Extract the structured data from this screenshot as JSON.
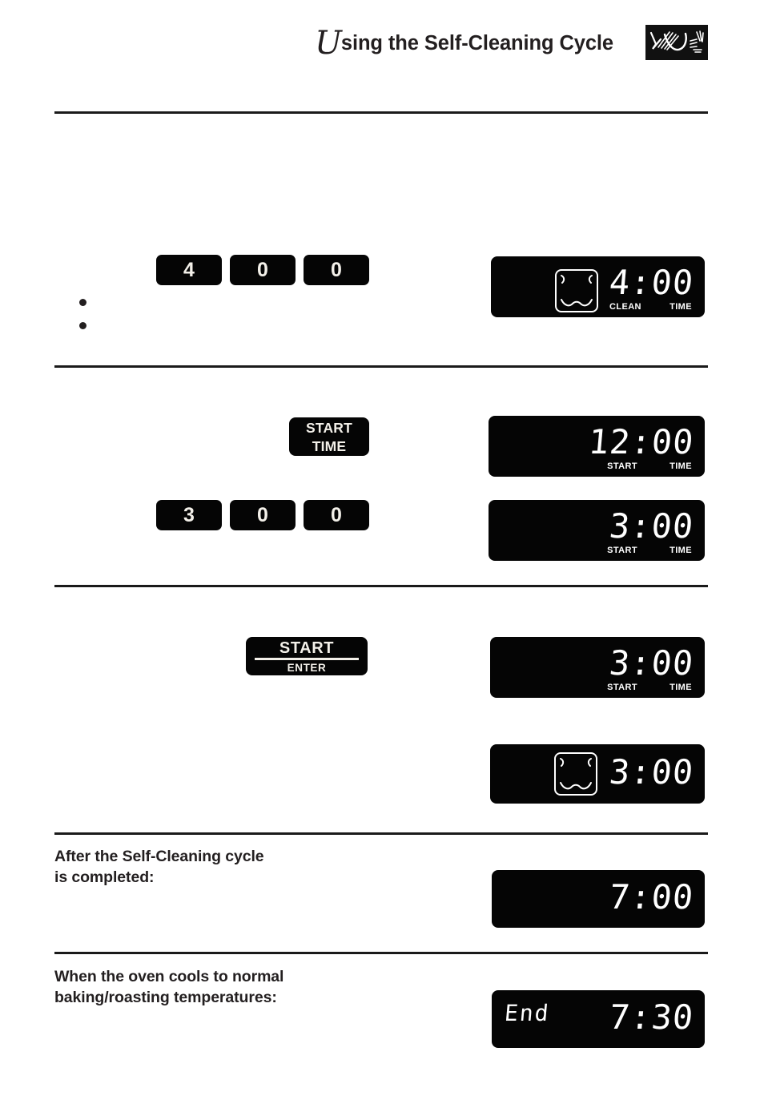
{
  "page": {
    "header": {
      "drop_cap": "U",
      "title_rest": "sing the Self-Cleaning Cycle",
      "logo_icon": "brush-stroke-logo"
    },
    "colors": {
      "ink": "#231f20",
      "panel": "#050505",
      "led": "#ffffff",
      "key_text": "#f3f0e9"
    }
  },
  "steps": [
    {
      "keys": [
        "4",
        "0",
        "0"
      ],
      "display": {
        "icon": "clean-oven-icon",
        "left_text": "",
        "value": "4:00",
        "labels": {
          "clean": "CLEAN",
          "start": "",
          "time": "TIME"
        }
      },
      "bullets": [
        "",
        ""
      ]
    },
    {
      "button": {
        "line1": "START",
        "line2": "TIME"
      },
      "display": {
        "icon": "",
        "left_text": "",
        "value": "12:00",
        "labels": {
          "clean": "",
          "start": "START",
          "time": "TIME"
        }
      }
    },
    {
      "keys": [
        "3",
        "0",
        "0"
      ],
      "display": {
        "icon": "",
        "left_text": "",
        "value": "3:00",
        "labels": {
          "clean": "",
          "start": "START",
          "time": "TIME"
        }
      }
    },
    {
      "button": {
        "line1": "START",
        "line2": "ENTER"
      },
      "display": {
        "icon": "",
        "left_text": "",
        "value": "3:00",
        "labels": {
          "clean": "",
          "start": "START",
          "time": "TIME"
        }
      }
    },
    {
      "display": {
        "icon": "clean-oven-icon",
        "left_text": "",
        "value": "3:00",
        "labels": {
          "clean": "",
          "start": "",
          "time": ""
        }
      }
    },
    {
      "caption": "After the Self-Cleaning cycle\nis completed:",
      "caption_line1": "After the Self-Cleaning cycle",
      "caption_line2": "is completed:",
      "display": {
        "icon": "",
        "left_text": "",
        "value": "7:00",
        "labels": {
          "clean": "",
          "start": "",
          "time": ""
        }
      }
    },
    {
      "caption_line1": "When the oven cools to normal",
      "caption_line2": "baking/roasting temperatures:",
      "display": {
        "icon": "",
        "left_text": "End",
        "value": "7:30",
        "labels": {
          "clean": "",
          "start": "",
          "time": ""
        }
      }
    }
  ]
}
